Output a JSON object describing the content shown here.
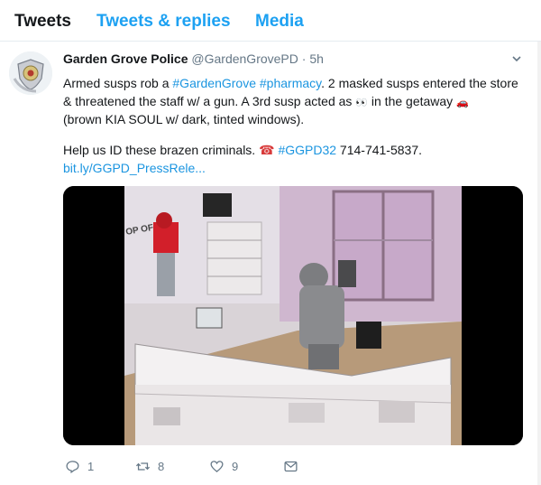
{
  "tabs": [
    {
      "label": "Tweets",
      "active": true
    },
    {
      "label": "Tweets & replies",
      "active": false
    },
    {
      "label": "Media",
      "active": false
    }
  ],
  "tweet": {
    "author_name": "Garden Grove Police",
    "handle": "@GardenGrovePD",
    "separator": "·",
    "time": "5h",
    "line1_prefix": "Armed susps rob a ",
    "hashtag1": "#GardenGrove",
    "hashtag2": "#pharmacy",
    "line1_suffix": ". 2 masked susps entered the store",
    "line2": "& threatened the staff w/ a gun. A 3rd susp acted as ",
    "line2_eyes": "👀",
    "line2_suffix": " in the getaway ",
    "line2_car": "🚗",
    "line3": "(brown KIA SOUL w/ dark, tinted windows).",
    "line4_prefix": "Help us ID these brazen criminals. ",
    "line4_phone": "☎",
    "hashtag3": "#GGPD32",
    "line4_suffix": " 714-741-5837.",
    "link": "bit.ly/GGPD_PressRele...",
    "media_sign": "OP OFF"
  },
  "actions": {
    "reply_count": "1",
    "retweet_count": "8",
    "like_count": "9"
  },
  "colors": {
    "link": "#1b95e0",
    "tab_active": "#14171a",
    "tab_inactive": "#1da1f2",
    "muted": "#657786"
  },
  "icons": {
    "avatar": "police-badge-icon",
    "caret": "chevron-down-icon",
    "reply": "reply-icon",
    "retweet": "retweet-icon",
    "like": "heart-icon",
    "dm": "envelope-icon"
  }
}
